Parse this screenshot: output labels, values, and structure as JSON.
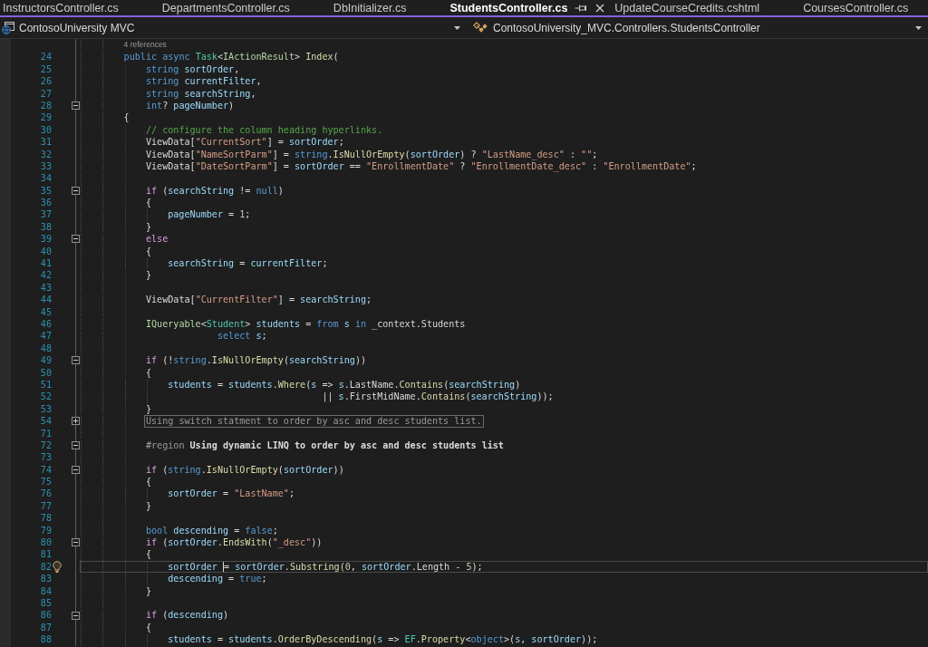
{
  "tabs": [
    {
      "label": "InstructorsController.cs",
      "selected": false
    },
    {
      "label": "DepartmentsController.cs",
      "selected": false
    },
    {
      "label": "DbInitializer.cs",
      "selected": false
    },
    {
      "label": "StudentsController.cs",
      "selected": true
    },
    {
      "label": "UpdateCourseCredits.cshtml",
      "selected": false
    },
    {
      "label": "CoursesController.cs",
      "selected": false
    }
  ],
  "navigation": {
    "project": "ContosoUniversity MVC",
    "type": "ContosoUniversity_MVC.Controllers.StudentsController"
  },
  "editor": {
    "lines": [
      {
        "number": "24",
        "current": false,
        "lightbulb": false,
        "codelens": "4 references",
        "tokens": [
          {
            "text": "        public async ",
            "kind": "keyword"
          },
          {
            "text": "Task",
            "kind": "type"
          },
          {
            "text": "<",
            "kind": "plain"
          },
          {
            "text": "IActionResult",
            "kind": "interface"
          },
          {
            "text": "> ",
            "kind": "plain"
          },
          {
            "text": "Index",
            "kind": "method"
          },
          {
            "text": "(",
            "kind": "plain"
          }
        ]
      },
      {
        "number": "25",
        "current": false,
        "lightbulb": false,
        "tokens": [
          {
            "text": "            string ",
            "kind": "keyword"
          },
          {
            "text": "sortOrder",
            "kind": "variable"
          },
          {
            "text": ",",
            "kind": "plain"
          }
        ]
      },
      {
        "number": "26",
        "current": false,
        "lightbulb": false,
        "tokens": [
          {
            "text": "            string ",
            "kind": "keyword"
          },
          {
            "text": "currentFilter",
            "kind": "variable"
          },
          {
            "text": ",",
            "kind": "plain"
          }
        ]
      },
      {
        "number": "27",
        "current": false,
        "lightbulb": false,
        "tokens": [
          {
            "text": "            string ",
            "kind": "keyword"
          },
          {
            "text": "searchString",
            "kind": "variable"
          },
          {
            "text": ",",
            "kind": "plain"
          }
        ]
      },
      {
        "number": "28",
        "current": false,
        "lightbulb": false,
        "fold": {
          "expanded": true
        },
        "tokens": [
          {
            "text": "            int",
            "kind": "keyword"
          },
          {
            "text": "? ",
            "kind": "plain"
          },
          {
            "text": "pageNumber",
            "kind": "variable"
          },
          {
            "text": ")",
            "kind": "plain"
          }
        ]
      },
      {
        "number": "29",
        "current": false,
        "lightbulb": false,
        "tokens": [
          {
            "text": "        {",
            "kind": "plain"
          }
        ]
      },
      {
        "number": "30",
        "current": false,
        "lightbulb": false,
        "tokens": [
          {
            "text": "            // configure the column heading hyperlinks.",
            "kind": "comment"
          }
        ]
      },
      {
        "number": "31",
        "current": false,
        "lightbulb": false,
        "tokens": [
          {
            "text": "            ViewData[",
            "kind": "plain"
          },
          {
            "text": "\"CurrentSort\"",
            "kind": "string"
          },
          {
            "text": "] = ",
            "kind": "plain"
          },
          {
            "text": "sortOrder",
            "kind": "variable"
          },
          {
            "text": ";",
            "kind": "plain"
          }
        ]
      },
      {
        "number": "32",
        "current": false,
        "lightbulb": false,
        "tokens": [
          {
            "text": "            ViewData[",
            "kind": "plain"
          },
          {
            "text": "\"NameSortParm\"",
            "kind": "string"
          },
          {
            "text": "] = ",
            "kind": "plain"
          },
          {
            "text": "string",
            "kind": "keyword"
          },
          {
            "text": ".",
            "kind": "plain"
          },
          {
            "text": "IsNullOrEmpty",
            "kind": "method"
          },
          {
            "text": "(",
            "kind": "plain"
          },
          {
            "text": "sortOrder",
            "kind": "variable"
          },
          {
            "text": ") ? ",
            "kind": "plain"
          },
          {
            "text": "\"LastName_desc\"",
            "kind": "string"
          },
          {
            "text": " : ",
            "kind": "plain"
          },
          {
            "text": "\"\"",
            "kind": "string"
          },
          {
            "text": ";",
            "kind": "plain"
          }
        ]
      },
      {
        "number": "33",
        "current": false,
        "lightbulb": false,
        "tokens": [
          {
            "text": "            ViewData[",
            "kind": "plain"
          },
          {
            "text": "\"DateSortParm\"",
            "kind": "string"
          },
          {
            "text": "] = ",
            "kind": "plain"
          },
          {
            "text": "sortOrder",
            "kind": "variable"
          },
          {
            "text": " == ",
            "kind": "plain"
          },
          {
            "text": "\"EnrollmentDate\"",
            "kind": "string"
          },
          {
            "text": " ? ",
            "kind": "plain"
          },
          {
            "text": "\"EnrollmentDate_desc\"",
            "kind": "string"
          },
          {
            "text": " : ",
            "kind": "plain"
          },
          {
            "text": "\"EnrollmentDate\"",
            "kind": "string"
          },
          {
            "text": ";",
            "kind": "plain"
          }
        ]
      },
      {
        "number": "34",
        "current": false,
        "lightbulb": false
      },
      {
        "number": "35",
        "current": false,
        "lightbulb": false,
        "fold": {
          "expanded": true
        },
        "tokens": [
          {
            "text": "            if",
            "kind": "control"
          },
          {
            "text": " (",
            "kind": "plain"
          },
          {
            "text": "searchString",
            "kind": "variable"
          },
          {
            "text": " != ",
            "kind": "plain"
          },
          {
            "text": "null",
            "kind": "keyword"
          },
          {
            "text": ")",
            "kind": "plain"
          }
        ]
      },
      {
        "number": "36",
        "current": false,
        "lightbulb": false,
        "tokens": [
          {
            "text": "            {",
            "kind": "plain"
          }
        ]
      },
      {
        "number": "37",
        "current": false,
        "lightbulb": false,
        "tokens": [
          {
            "text": "                pageNumber",
            "kind": "variable"
          },
          {
            "text": " = ",
            "kind": "plain"
          },
          {
            "text": "1",
            "kind": "number"
          },
          {
            "text": ";",
            "kind": "plain"
          }
        ]
      },
      {
        "number": "38",
        "current": false,
        "lightbulb": false,
        "tokens": [
          {
            "text": "            }",
            "kind": "plain"
          }
        ]
      },
      {
        "number": "39",
        "current": false,
        "lightbulb": false,
        "fold": {
          "expanded": true
        },
        "tokens": [
          {
            "text": "            else",
            "kind": "control"
          }
        ]
      },
      {
        "number": "40",
        "current": false,
        "lightbulb": false,
        "tokens": [
          {
            "text": "            {",
            "kind": "plain"
          }
        ]
      },
      {
        "number": "41",
        "current": false,
        "lightbulb": false,
        "tokens": [
          {
            "text": "                searchString",
            "kind": "variable"
          },
          {
            "text": " = ",
            "kind": "plain"
          },
          {
            "text": "currentFilter",
            "kind": "variable"
          },
          {
            "text": ";",
            "kind": "plain"
          }
        ]
      },
      {
        "number": "42",
        "current": false,
        "lightbulb": false,
        "tokens": [
          {
            "text": "            }",
            "kind": "plain"
          }
        ]
      },
      {
        "number": "43",
        "current": false,
        "lightbulb": false
      },
      {
        "number": "44",
        "current": false,
        "lightbulb": false,
        "tokens": [
          {
            "text": "            ViewData[",
            "kind": "plain"
          },
          {
            "text": "\"CurrentFilter\"",
            "kind": "string"
          },
          {
            "text": "] = ",
            "kind": "plain"
          },
          {
            "text": "searchString",
            "kind": "variable"
          },
          {
            "text": ";",
            "kind": "plain"
          }
        ]
      },
      {
        "number": "45",
        "current": false,
        "lightbulb": false
      },
      {
        "number": "46",
        "current": false,
        "lightbulb": false,
        "tokens": [
          {
            "text": "            IQueryable",
            "kind": "interface"
          },
          {
            "text": "<",
            "kind": "plain"
          },
          {
            "text": "Student",
            "kind": "type"
          },
          {
            "text": "> ",
            "kind": "plain"
          },
          {
            "text": "students",
            "kind": "variable"
          },
          {
            "text": " = ",
            "kind": "plain"
          },
          {
            "text": "from ",
            "kind": "keyword"
          },
          {
            "text": "s",
            "kind": "variable"
          },
          {
            "text": " in",
            "kind": "keyword"
          },
          {
            "text": " _context.Students",
            "kind": "plain"
          }
        ]
      },
      {
        "number": "47",
        "current": false,
        "lightbulb": false,
        "tokens": [
          {
            "text": "                         select ",
            "kind": "keyword"
          },
          {
            "text": "s",
            "kind": "variable"
          },
          {
            "text": ";",
            "kind": "plain"
          }
        ]
      },
      {
        "number": "48",
        "current": false,
        "lightbulb": false
      },
      {
        "number": "49",
        "current": false,
        "lightbulb": false,
        "fold": {
          "expanded": true
        },
        "tokens": [
          {
            "text": "            if",
            "kind": "control"
          },
          {
            "text": " (!",
            "kind": "plain"
          },
          {
            "text": "string",
            "kind": "keyword"
          },
          {
            "text": ".",
            "kind": "plain"
          },
          {
            "text": "IsNullOrEmpty",
            "kind": "method"
          },
          {
            "text": "(",
            "kind": "plain"
          },
          {
            "text": "searchString",
            "kind": "variable"
          },
          {
            "text": "))",
            "kind": "plain"
          }
        ]
      },
      {
        "number": "50",
        "current": false,
        "lightbulb": false,
        "tokens": [
          {
            "text": "            {",
            "kind": "plain"
          }
        ]
      },
      {
        "number": "51",
        "current": false,
        "lightbulb": false,
        "tokens": [
          {
            "text": "                students",
            "kind": "variable"
          },
          {
            "text": " = ",
            "kind": "plain"
          },
          {
            "text": "students",
            "kind": "variable"
          },
          {
            "text": ".",
            "kind": "plain"
          },
          {
            "text": "Where",
            "kind": "method"
          },
          {
            "text": "(",
            "kind": "plain"
          },
          {
            "text": "s",
            "kind": "variable"
          },
          {
            "text": " => ",
            "kind": "plain"
          },
          {
            "text": "s",
            "kind": "variable"
          },
          {
            "text": ".LastName.",
            "kind": "plain"
          },
          {
            "text": "Contains",
            "kind": "method"
          },
          {
            "text": "(",
            "kind": "plain"
          },
          {
            "text": "searchString",
            "kind": "variable"
          },
          {
            "text": ")",
            "kind": "plain"
          }
        ]
      },
      {
        "number": "52",
        "current": false,
        "lightbulb": false,
        "tokens": [
          {
            "text": "                                            || ",
            "kind": "plain"
          },
          {
            "text": "s",
            "kind": "variable"
          },
          {
            "text": ".FirstMidName.",
            "kind": "plain"
          },
          {
            "text": "Contains",
            "kind": "method"
          },
          {
            "text": "(",
            "kind": "plain"
          },
          {
            "text": "searchString",
            "kind": "variable"
          },
          {
            "text": "));",
            "kind": "plain"
          }
        ]
      },
      {
        "number": "53",
        "current": false,
        "lightbulb": false,
        "tokens": [
          {
            "text": "            }",
            "kind": "plain"
          }
        ]
      },
      {
        "number": "54",
        "current": false,
        "lightbulb": false,
        "fold": {
          "expanded": false
        },
        "tokens": [
          {
            "text": "            Using switch statment to order by asc and desc students list.",
            "kind": "collapsed"
          }
        ]
      },
      {
        "number": "71",
        "current": false,
        "lightbulb": false
      },
      {
        "number": "72",
        "current": false,
        "lightbulb": false,
        "fold": {
          "expanded": true
        },
        "tokens": [
          {
            "text": "            #region ",
            "kind": "preprocessor"
          },
          {
            "text": "Using dynamic LINQ to order by asc and desc students list",
            "kind": "region"
          }
        ]
      },
      {
        "number": "73",
        "current": false,
        "lightbulb": false
      },
      {
        "number": "74",
        "current": false,
        "lightbulb": false,
        "fold": {
          "expanded": true
        },
        "tokens": [
          {
            "text": "            if",
            "kind": "control"
          },
          {
            "text": " (",
            "kind": "plain"
          },
          {
            "text": "string",
            "kind": "keyword"
          },
          {
            "text": ".",
            "kind": "plain"
          },
          {
            "text": "IsNullOrEmpty",
            "kind": "method"
          },
          {
            "text": "(",
            "kind": "plain"
          },
          {
            "text": "sortOrder",
            "kind": "variable"
          },
          {
            "text": "))",
            "kind": "plain"
          }
        ]
      },
      {
        "number": "75",
        "current": false,
        "lightbulb": false,
        "tokens": [
          {
            "text": "            {",
            "kind": "plain"
          }
        ]
      },
      {
        "number": "76",
        "current": false,
        "lightbulb": false,
        "tokens": [
          {
            "text": "                sortOrder",
            "kind": "variable"
          },
          {
            "text": " = ",
            "kind": "plain"
          },
          {
            "text": "\"LastName\"",
            "kind": "string"
          },
          {
            "text": ";",
            "kind": "plain"
          }
        ]
      },
      {
        "number": "77",
        "current": false,
        "lightbulb": false,
        "tokens": [
          {
            "text": "            }",
            "kind": "plain"
          }
        ]
      },
      {
        "number": "78",
        "current": false,
        "lightbulb": false
      },
      {
        "number": "79",
        "current": false,
        "lightbulb": false,
        "tokens": [
          {
            "text": "            bool ",
            "kind": "keyword"
          },
          {
            "text": "descending",
            "kind": "variable"
          },
          {
            "text": " = ",
            "kind": "plain"
          },
          {
            "text": "false",
            "kind": "keyword"
          },
          {
            "text": ";",
            "kind": "plain"
          }
        ]
      },
      {
        "number": "80",
        "current": false,
        "lightbulb": false,
        "fold": {
          "expanded": true
        },
        "tokens": [
          {
            "text": "            if",
            "kind": "control"
          },
          {
            "text": " (",
            "kind": "plain"
          },
          {
            "text": "sortOrder",
            "kind": "variable"
          },
          {
            "text": ".",
            "kind": "plain"
          },
          {
            "text": "EndsWith",
            "kind": "method"
          },
          {
            "text": "(",
            "kind": "plain"
          },
          {
            "text": "\"_desc\"",
            "kind": "string"
          },
          {
            "text": "))",
            "kind": "plain"
          }
        ]
      },
      {
        "number": "81",
        "current": false,
        "lightbulb": false,
        "tokens": [
          {
            "text": "            {",
            "kind": "plain"
          }
        ]
      },
      {
        "number": "82",
        "current": true,
        "lightbulb": true,
        "tokens": [
          {
            "text": "                sortOrder ",
            "kind": "variable"
          },
          {
            "kind": "caret"
          },
          {
            "text": "= ",
            "kind": "plain"
          },
          {
            "text": "sortOrder",
            "kind": "variable"
          },
          {
            "text": ".",
            "kind": "plain"
          },
          {
            "text": "Substring",
            "kind": "method"
          },
          {
            "text": "(",
            "kind": "plain"
          },
          {
            "text": "0",
            "kind": "number"
          },
          {
            "text": ", ",
            "kind": "plain"
          },
          {
            "text": "sortOrder",
            "kind": "variable"
          },
          {
            "text": ".Length - ",
            "kind": "plain"
          },
          {
            "text": "5",
            "kind": "number"
          },
          {
            "text": ");",
            "kind": "plain"
          }
        ]
      },
      {
        "number": "83",
        "current": false,
        "lightbulb": false,
        "tokens": [
          {
            "text": "                descending",
            "kind": "variable"
          },
          {
            "text": " = ",
            "kind": "plain"
          },
          {
            "text": "true",
            "kind": "keyword"
          },
          {
            "text": ";",
            "kind": "plain"
          }
        ]
      },
      {
        "number": "84",
        "current": false,
        "lightbulb": false,
        "tokens": [
          {
            "text": "            }",
            "kind": "plain"
          }
        ]
      },
      {
        "number": "85",
        "current": false,
        "lightbulb": false
      },
      {
        "number": "86",
        "current": false,
        "lightbulb": false,
        "fold": {
          "expanded": true
        },
        "tokens": [
          {
            "text": "            if",
            "kind": "control"
          },
          {
            "text": " (",
            "kind": "plain"
          },
          {
            "text": "descending",
            "kind": "variable"
          },
          {
            "text": ")",
            "kind": "plain"
          }
        ]
      },
      {
        "number": "87",
        "current": false,
        "lightbulb": false,
        "tokens": [
          {
            "text": "            {",
            "kind": "plain"
          }
        ]
      },
      {
        "number": "88",
        "current": false,
        "lightbulb": false,
        "tokens": [
          {
            "text": "                students",
            "kind": "variable"
          },
          {
            "text": " = ",
            "kind": "plain"
          },
          {
            "text": "students",
            "kind": "variable"
          },
          {
            "text": ".",
            "kind": "plain"
          },
          {
            "text": "OrderByDescending",
            "kind": "method"
          },
          {
            "text": "(",
            "kind": "plain"
          },
          {
            "text": "s",
            "kind": "variable"
          },
          {
            "text": " => ",
            "kind": "plain"
          },
          {
            "text": "EF",
            "kind": "type"
          },
          {
            "text": ".",
            "kind": "plain"
          },
          {
            "text": "Property",
            "kind": "method"
          },
          {
            "text": "<",
            "kind": "plain"
          },
          {
            "text": "object",
            "kind": "keyword"
          },
          {
            "text": ">(",
            "kind": "plain"
          },
          {
            "text": "s",
            "kind": "variable"
          },
          {
            "text": ", ",
            "kind": "plain"
          },
          {
            "text": "sortOrder",
            "kind": "variable"
          },
          {
            "text": "));",
            "kind": "plain"
          }
        ]
      }
    ]
  }
}
